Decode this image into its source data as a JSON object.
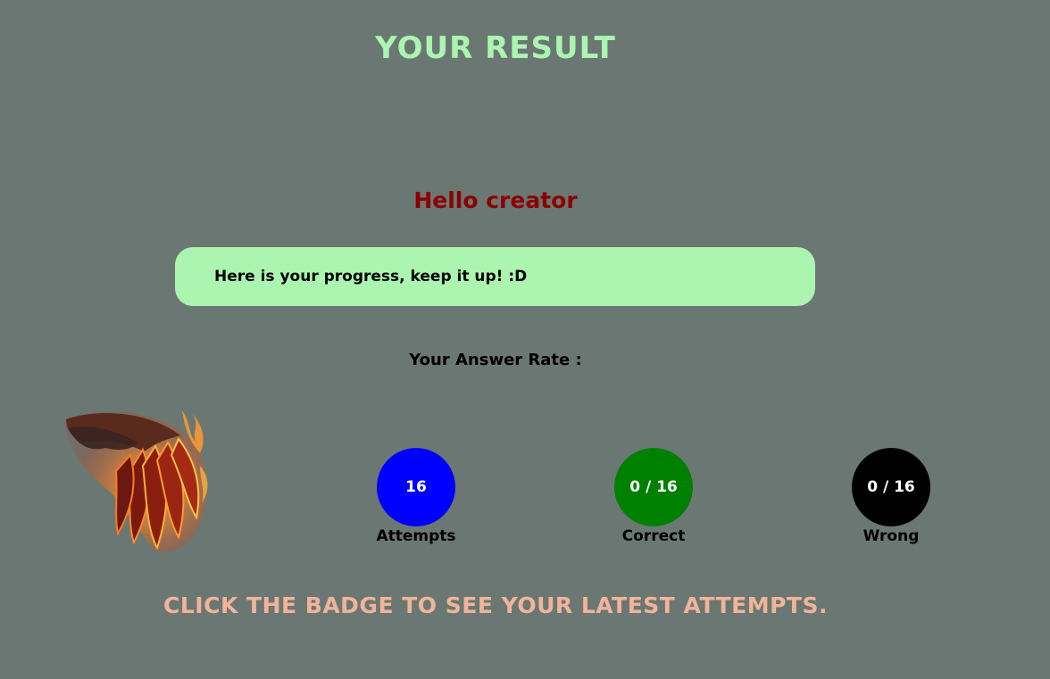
{
  "header": {
    "title": "Your Result"
  },
  "greeting": "Hello creator",
  "progress_message": "Here is your progress, keep it up! :D",
  "answer_rate_label": "Your Answer Rate :",
  "badge": {
    "icon": "flaming-wing-icon"
  },
  "stats": [
    {
      "value": "16",
      "label": "Attempts",
      "color": "#0000ff"
    },
    {
      "value": "0 / 16",
      "label": "Correct",
      "color": "#008000"
    },
    {
      "value": "0 / 16",
      "label": "Wrong",
      "color": "#000000"
    }
  ],
  "footer": {
    "instruction": "Click the badge to see your latest attempts."
  },
  "colors": {
    "background": "#6b7772",
    "title": "#abf5b0",
    "greeting": "#8b0000",
    "progress_box": "#abf5b0",
    "footer": "#f0b49a"
  }
}
